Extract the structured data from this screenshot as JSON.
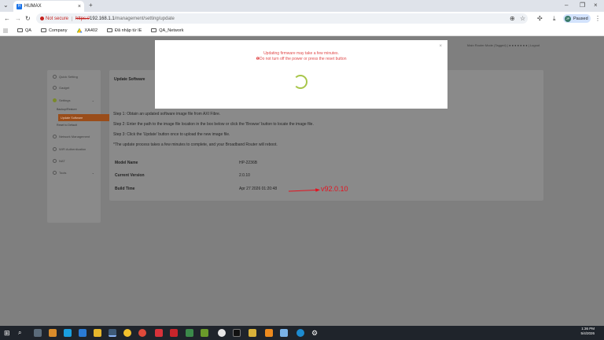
{
  "browser": {
    "tab_title": "HUMAX",
    "tab_fav": "H",
    "security_label": "Not secure",
    "url_proto": "https://",
    "url_host": "192.168.1.1",
    "url_path": "/management/setting/update",
    "profile_initials": "JP",
    "profile_status": "Paused",
    "bookmarks": [
      "QA",
      "Company",
      "XA402",
      "Đã nhập từ IE",
      "QA_Network"
    ]
  },
  "router": {
    "top_info": "Main Router Mode (Tagged)  |  ●  ● ● ● ● ● ●  |  Logout",
    "sidebar": {
      "items": [
        "Quick Setting",
        "Gadget",
        "Settings",
        "Network Management",
        "WiFi Authentication",
        "NAT",
        "Tools"
      ],
      "subitems": [
        "Backup/Restore",
        "Update Software",
        "Reset to Default"
      ]
    },
    "content": {
      "title": "Update Software",
      "steps": [
        "Step 1: Obtain an updated software image file from AXI Fibre.",
        "Step 2: Enter the path to the image file location in the box below or click the 'Browse' button to locate the image file.",
        "Step 3: Click the 'Update' button once to upload the new image file.",
        "*The update process takes a few minutes to complete, and your Broadband Router will reboot."
      ],
      "model_name_label": "Model Name",
      "model_name_value": "HP-2236B",
      "current_version_label": "Current Version",
      "current_version_value": "2.0.10",
      "build_time_label": "Build Time",
      "build_time_value": "Apr 27 2026 01:20:48"
    },
    "annotation": "v92.0.10"
  },
  "modal": {
    "message1": "Updating firmware may take a few minutes.",
    "message2": "❶Do not turn off the power or press the reset button",
    "close": "×"
  },
  "taskbar": {
    "time": "1:36 PM",
    "date": "5/4/2026"
  },
  "colors": {
    "modal_text": "#e0494a",
    "spinner": "#a8c64a",
    "annotation": "#e5121f",
    "active_subitem": "#9a4d1a"
  }
}
